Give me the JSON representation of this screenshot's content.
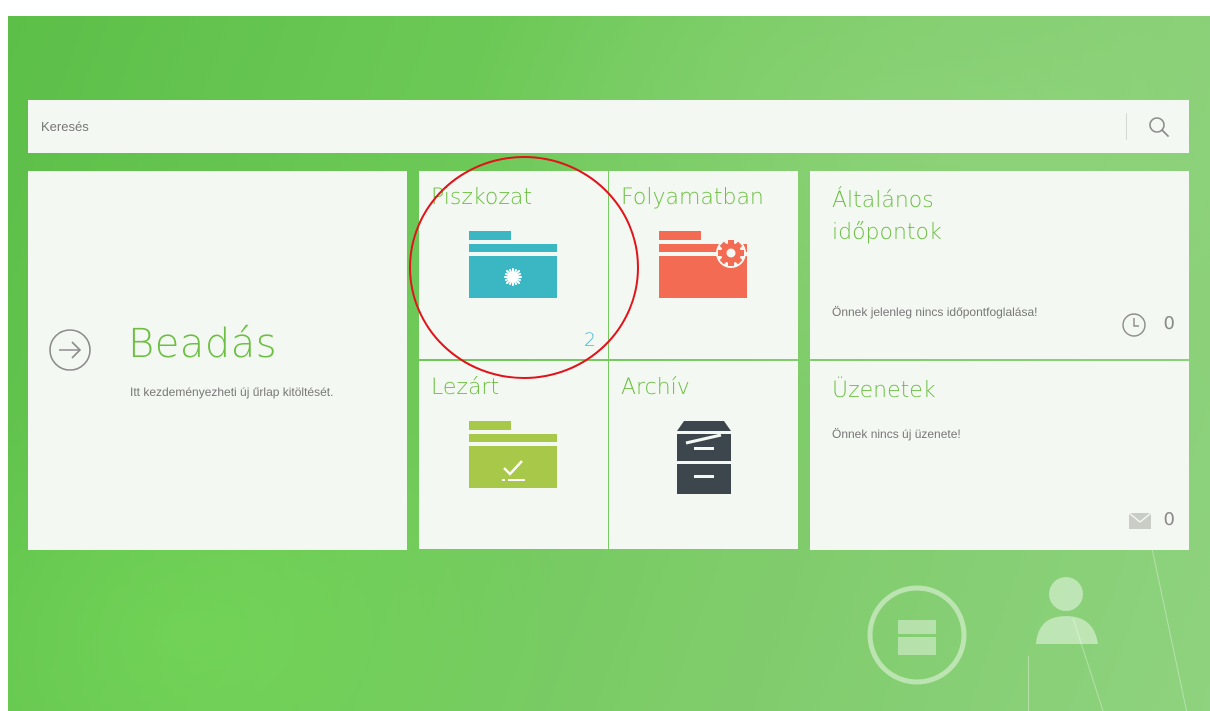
{
  "search": {
    "placeholder": "Keresés",
    "icon": "search-icon"
  },
  "tiles": {
    "beadas": {
      "title": "Beadás",
      "description": "Itt kezdeményezheti új űrlap kitöltését.",
      "icon": "arrow-circle-icon"
    },
    "piszkozat": {
      "title": "Piszkozat",
      "count": "2",
      "icon": "draft-folder-icon",
      "color": "#3bb7c4"
    },
    "folyamatban": {
      "title": "Folyamatban",
      "icon": "in-progress-folder-icon",
      "color": "#f26b52"
    },
    "lezart": {
      "title": "Lezárt",
      "icon": "closed-folder-icon",
      "color": "#a8c84a"
    },
    "archiv": {
      "title": "Archív",
      "icon": "archive-cabinet-icon",
      "color": "#3d464d"
    },
    "idopontok": {
      "title": "Általános időpontok",
      "message": "Önnek jelenleg nincs időpontfoglalása!",
      "count": "0",
      "icon": "clock-icon"
    },
    "uzenetek": {
      "title": "Üzenetek",
      "message": "Önnek nincs új üzenete!",
      "count": "0",
      "icon": "envelope-icon"
    }
  },
  "accent_color": "#6cbf43",
  "highlight_color": "#e0141b"
}
